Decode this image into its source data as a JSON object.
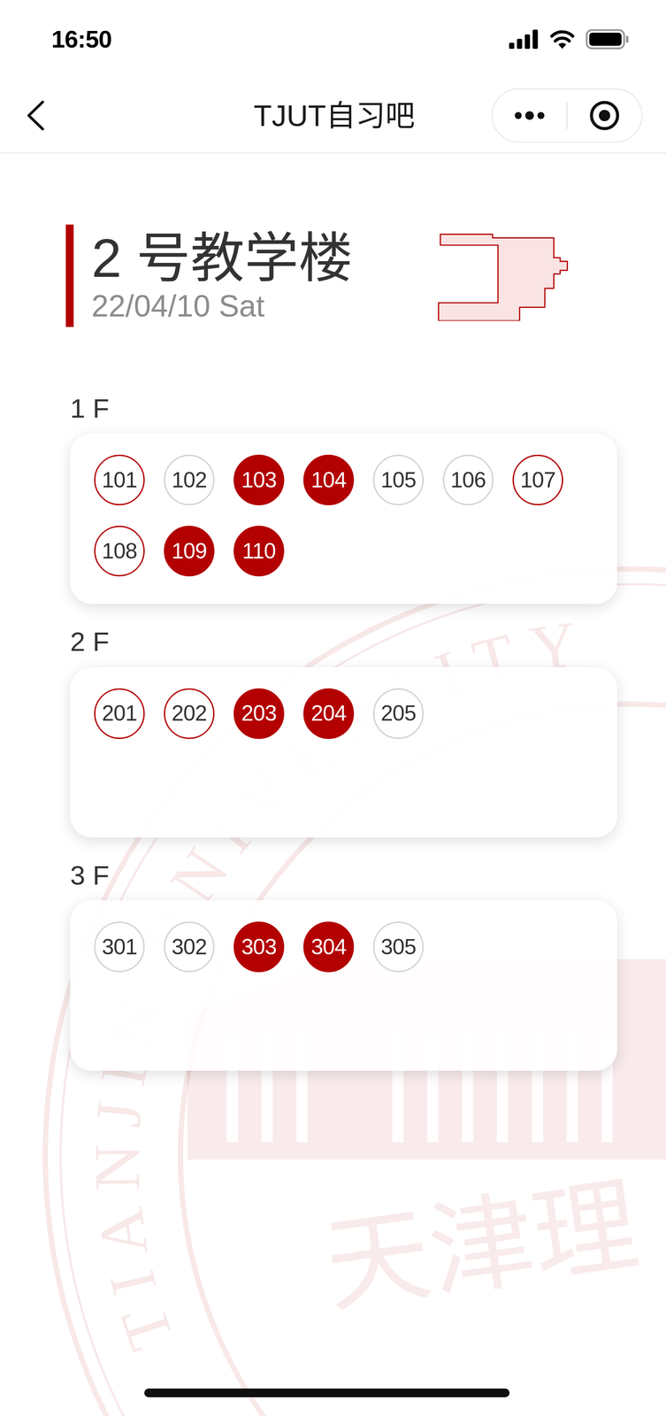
{
  "status_bar": {
    "time": "16:50"
  },
  "nav": {
    "title": "TJUT自习吧"
  },
  "building": {
    "name": "2 号教学楼",
    "date": "22/04/10 Sat"
  },
  "floors": [
    {
      "label": "1 F",
      "rooms": [
        {
          "number": "101",
          "status": "partial"
        },
        {
          "number": "102",
          "status": "free"
        },
        {
          "number": "103",
          "status": "busy"
        },
        {
          "number": "104",
          "status": "busy"
        },
        {
          "number": "105",
          "status": "free"
        },
        {
          "number": "106",
          "status": "free"
        },
        {
          "number": "107",
          "status": "partial"
        },
        {
          "number": "108",
          "status": "partial"
        },
        {
          "number": "109",
          "status": "busy"
        },
        {
          "number": "110",
          "status": "busy"
        }
      ]
    },
    {
      "label": "2 F",
      "rooms": [
        {
          "number": "201",
          "status": "partial"
        },
        {
          "number": "202",
          "status": "partial"
        },
        {
          "number": "203",
          "status": "busy"
        },
        {
          "number": "204",
          "status": "busy"
        },
        {
          "number": "205",
          "status": "free"
        }
      ]
    },
    {
      "label": "3 F",
      "rooms": [
        {
          "number": "301",
          "status": "free"
        },
        {
          "number": "302",
          "status": "free"
        },
        {
          "number": "303",
          "status": "busy"
        },
        {
          "number": "304",
          "status": "busy"
        },
        {
          "number": "305",
          "status": "free"
        }
      ]
    }
  ],
  "watermark": {
    "ring_text": "TIANJIN UNIVERSITY",
    "name": "天津理"
  }
}
